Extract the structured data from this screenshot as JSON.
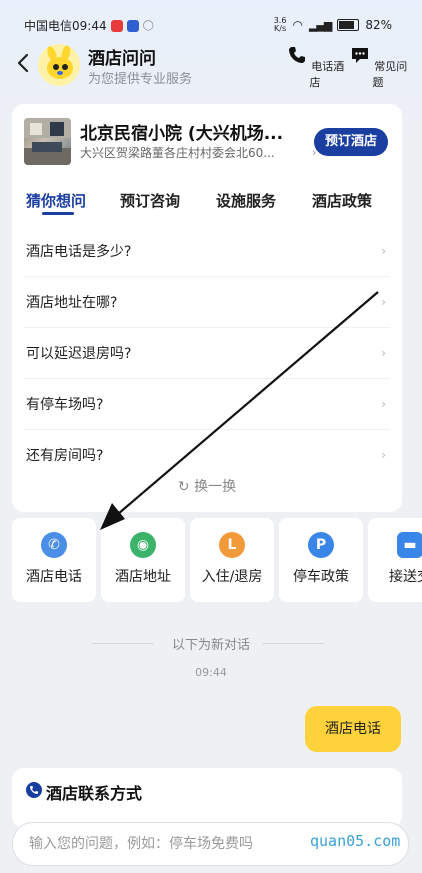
{
  "status_bar": {
    "carrier_time": "中国电信09:44",
    "net_speed_value": "3.6",
    "net_speed_unit": "K/s",
    "battery": "82%"
  },
  "header": {
    "title": "酒店问问",
    "subtitle": "为您提供专业服务",
    "actions": [
      {
        "label": "电话酒店",
        "icon": "phone-icon"
      },
      {
        "label": "常见问题",
        "icon": "chat-icon"
      }
    ]
  },
  "hotel": {
    "name": "北京民宿小院 (大兴机场...",
    "address": "大兴区贺梁路董各庄村村委会北60...",
    "book_label": "预订酒店"
  },
  "tabs": [
    "猜你想问",
    "预订咨询",
    "设施服务",
    "酒店政策"
  ],
  "questions": [
    "酒店电话是多少?",
    "酒店地址在哪?",
    "可以延迟退房吗?",
    "有停车场吗?",
    "还有房间吗?"
  ],
  "refresh_label": "换一换",
  "quick_actions": [
    {
      "label": "酒店电话",
      "icon": "phone-icon",
      "color": "#4a8ee8"
    },
    {
      "label": "酒店地址",
      "icon": "location-icon",
      "color": "#3bb36a"
    },
    {
      "label": "入住/退房",
      "icon": "clock-icon",
      "color": "#f29a3a"
    },
    {
      "label": "停车政策",
      "icon": "parking-icon",
      "color": "#3a86e8"
    },
    {
      "label": "接送交",
      "icon": "car-icon",
      "color": "#3a86e8"
    }
  ],
  "conversation": {
    "divider_label": "以下为新对话",
    "time": "09:44",
    "user_message": "酒店电话"
  },
  "contact": {
    "title": "酒店联系方式"
  },
  "input": {
    "placeholder": "输入您的问题，例如：停车场免费吗"
  },
  "watermark": "quan05.com",
  "colors": {
    "brand": "#1a3fa0",
    "bubble": "#fdd23a"
  }
}
